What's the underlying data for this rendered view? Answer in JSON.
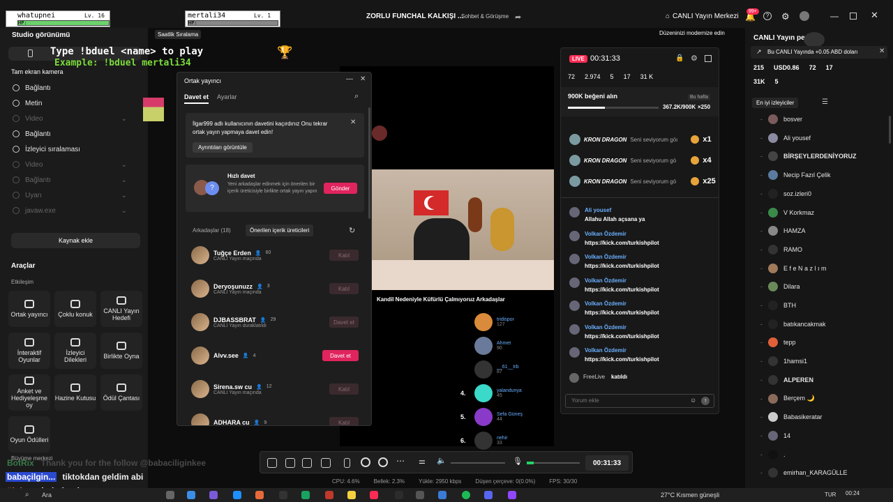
{
  "titlebar": {
    "title": "ZORLU FUNCHAL KALKIŞI ...",
    "category": "Sohbet & Görüşme",
    "live_center": "CANLI Yayın Merkezi",
    "notif_badge": "99+"
  },
  "overlay": {
    "player1": {
      "name": "whatupnei",
      "level": "Lv. 16",
      "hp": "HP:"
    },
    "player2": {
      "name": "mertali34",
      "level": "Lv. 1",
      "hp": "HP:"
    },
    "duel_line1": "Type !bduel <name> to play",
    "duel_line2": "Example: !bduel mertali34",
    "hourly": "Saatlik Sıralama",
    "modernize": "Düzeninizi modernize edin"
  },
  "left": {
    "studio_view": "Studio görünümü",
    "fullscreen": "Tam ekran kamera",
    "sources": [
      {
        "label": "Bağlantı",
        "dim": false
      },
      {
        "label": "Metin",
        "dim": false
      },
      {
        "label": "Video",
        "dim": true
      },
      {
        "label": "Bağlantı",
        "dim": false
      },
      {
        "label": "İzleyici sıralaması",
        "dim": false
      },
      {
        "label": "Video",
        "dim": true
      },
      {
        "label": "Bağlantı",
        "dim": true
      },
      {
        "label": "Uyarı",
        "dim": true
      },
      {
        "label": "javaw.exe",
        "dim": true
      }
    ],
    "add_source": "Kaynak ekle",
    "tools_title": "Araçlar",
    "interaction": "Etkileşim",
    "tools": [
      "Ortak yayıncı",
      "Çoklu konuk",
      "CANLI Yayın Hedefi",
      "İnteraktif Oyunlar",
      "İzleyici Dilekleri",
      "Birlikte Oyna",
      "Anket ve Hediyeleşme oy",
      "Hazine Kutusu",
      "Ödül Çantası",
      "Oyun Ödülleri"
    ],
    "growth": "Büyüme merkezi",
    "chat_overlay": [
      {
        "user": "BotRix",
        "text": "Thank you for the follow @babaciliginkee"
      },
      {
        "user": "babaçilgin...",
        "text": "tiktokdan geldim abi"
      },
      {
        "user": "ühtlu...",
        "text": "hghghggh"
      }
    ]
  },
  "cohost": {
    "title": "Ortak yayıncı",
    "tab_invite": "Davet et",
    "tab_settings": "Ayarlar",
    "alert_text": "İlgar999 adlı kullanıcının davetini kaçırdınız Onu tekrar ortak yayın yapmaya davet edin!",
    "alert_button": "Ayrıntıları görüntüle",
    "quick_title": "Hızlı davet",
    "quick_desc": "Yeni arkadaşlar edinmek için önerilen bir içerik üreticisiyle birlikte ortak yayın yapın",
    "quick_button": "Gönder",
    "tab_friends": "Arkadaşlar (18)",
    "tab_suggested": "Önerilen içerik üreticileri",
    "friends": [
      {
        "name": "Tuğçe Erden",
        "count": "60",
        "status": "CANLI Yayın maçında",
        "button": "Katıl",
        "active": false
      },
      {
        "name": "Deryoşunuzz",
        "count": "3",
        "status": "CANLI Yayın maçında",
        "button": "Katıl",
        "active": false
      },
      {
        "name": "DJBASSBRAT",
        "count": "29",
        "status": "CANLI Yayın duraklatıldı",
        "button": "Davet et",
        "active": false
      },
      {
        "name": "Alvv.see",
        "count": "4",
        "status": "",
        "button": "Davet et",
        "active": true
      },
      {
        "name": "Sirena.sw cu",
        "count": "12",
        "status": "CANLI Yayın maçında",
        "button": "Katıl",
        "active": false
      },
      {
        "name": "ADHARA cu",
        "count": "9",
        "status": "",
        "button": "Katıl",
        "active": false
      }
    ]
  },
  "preview": {
    "caption": "Kandil Nedeniyle Küfürlü Çalmıyoruz Arkadaşlar",
    "ranking": [
      {
        "pos": "",
        "name": "tridispor",
        "value": "127"
      },
      {
        "pos": "",
        "name": "Ahmet",
        "value": "90"
      },
      {
        "pos": "",
        "name": "__61__trb",
        "value": "87"
      },
      {
        "pos": "4.",
        "name": "yalandunya",
        "value": "45"
      },
      {
        "pos": "5.",
        "name": "Sefa Güneş",
        "value": "44"
      },
      {
        "pos": "6.",
        "name": "nehir",
        "value": "33"
      }
    ]
  },
  "controls": {
    "timer": "00:31:33"
  },
  "status_bar": {
    "cpu": "CPU: 4.6%",
    "memory": "Bellek: 2.3%",
    "upload": "Yükle: 2950 kbps",
    "dropped": "Düşen çerçeve: 0(0.0%)",
    "fps": "FPS: 30/30"
  },
  "live_panel": {
    "badge": "LIVE",
    "time": "00:31:33",
    "stats": [
      "72",
      "2.974",
      "5",
      "17",
      "31 K"
    ],
    "goal_title": "900K beğeni alın",
    "goal_period": "Bu hafta",
    "goal_value": "367.2K/900K",
    "goal_reward": "×250",
    "goal_progress": 0.41,
    "gifts": [
      {
        "user": "KRON DRAGON",
        "text": "Seni seviyorum göı",
        "mult": "x1"
      },
      {
        "user": "KRON DRAGON",
        "text": "Seni seviyorum gö",
        "mult": "x4"
      },
      {
        "user": "KRON DRAGON",
        "text": "Seni seviyorum gö",
        "mult": "x25"
      }
    ],
    "chat": [
      {
        "user": "Ali yousef",
        "text": "Allahu Allah açsana ya"
      },
      {
        "user": "Volkan Özdemir",
        "text": "https://kick.com/turkishpilot"
      },
      {
        "user": "Volkan Özdemir",
        "text": "https://kick.com/turkishpilot"
      },
      {
        "user": "Volkan Özdemir",
        "text": "https://kick.com/turkishpilot"
      },
      {
        "user": "Volkan Özdemir",
        "text": "https://kick.com/turkishpilot"
      },
      {
        "user": "Volkan Özdemir",
        "text": "https://kick.com/turkishpilot"
      },
      {
        "user": "Volkan Özdemir",
        "text": "https://kick.com/turkishpilot"
      }
    ],
    "joined_user": "FreeLive",
    "joined_text": "katıldı",
    "comment_placeholder": "Yorum ekle"
  },
  "right": {
    "title": "CANLI Yayın pe",
    "promo": "Bu CANLI Yayında +0.05 ABD doları",
    "stats": [
      "215",
      "USD0.86",
      "72",
      "17"
    ],
    "stats2": [
      "31K",
      "5"
    ],
    "top_viewers": "En iyi izleyiciler",
    "viewers": [
      "bosver",
      "Ali yousef",
      "BİRŞEYLERDENİYORUZ",
      "Necip Fazıl Çelik",
      "soz.izleri0",
      "V Korkmaz",
      "HAMZA",
      "RAMO",
      "E f e N a z l ı m",
      "Dilara",
      "BTH",
      "batıkancakmak",
      "tepp",
      "1hamsi1",
      "ALPEREN",
      "Berçem 🌙",
      "Babasikeratar",
      "14",
      ".",
      "emirhan_KARAGÜLLE"
    ]
  },
  "taskbar": {
    "search": "Ara",
    "weather": "27°C  Kısmen güneşli",
    "lang": "TUR",
    "clock": "00:24"
  }
}
